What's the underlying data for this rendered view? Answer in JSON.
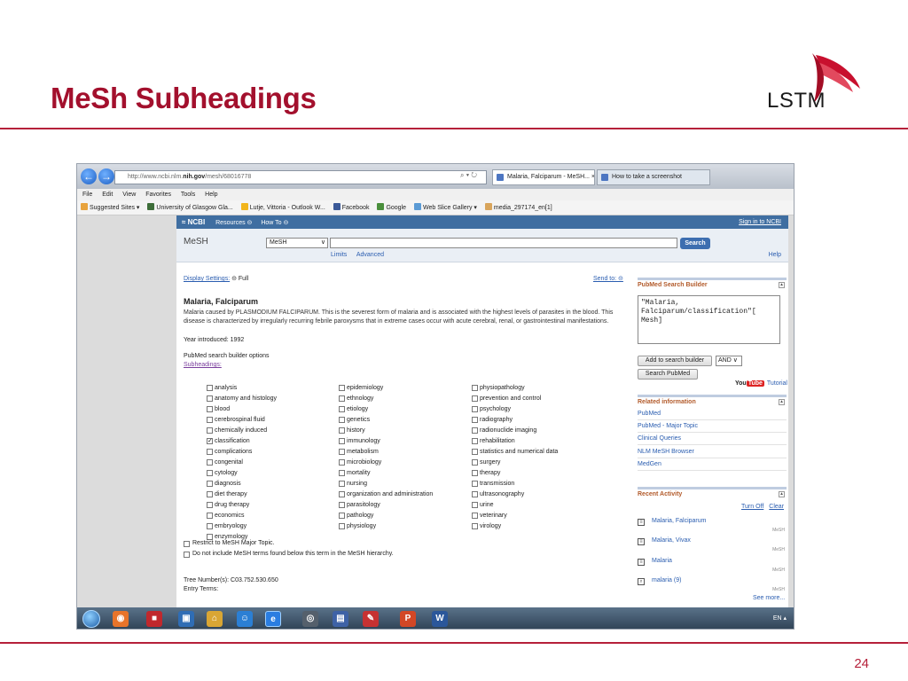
{
  "slide": {
    "title": "MeSh Subheadings",
    "logo_text": "LSTM",
    "page_number": "24"
  },
  "browser": {
    "address_prefix": "http://www.ncbi.nlm.",
    "address_host": "nih.gov",
    "address_suffix": "/mesh/68016778",
    "address_icons": "⌕ ▾ ↻",
    "back_icon": "←",
    "forward_icon": "→",
    "tabs": [
      {
        "label": "Malaria, Falciparum - MeSH... ×"
      },
      {
        "label": "How to take a screenshot"
      }
    ],
    "menu": [
      "File",
      "Edit",
      "View",
      "Favorites",
      "Tools",
      "Help"
    ],
    "favorites": [
      {
        "label": "Suggested Sites ▾",
        "color": "#e8a33d"
      },
      {
        "label": "University of Glasgow  Gla...",
        "color": "#3e6e3a"
      },
      {
        "label": "Lutje, Vittoria - Outlook W...",
        "color": "#f2b51c"
      },
      {
        "label": "Facebook",
        "color": "#3b5998"
      },
      {
        "label": "Google",
        "color": "#4a8f3c"
      },
      {
        "label": "Web Slice Gallery ▾",
        "color": "#5b9bd5"
      },
      {
        "label": "media_297174_en[1]",
        "color": "#d9a55c"
      }
    ]
  },
  "ncbi": {
    "brand": "≈ NCBI",
    "resources": "Resources ⊝",
    "howto": "How To ⊝",
    "sign_in": "Sign in to NCBI",
    "db_title": "MeSH",
    "db_selected": "MeSH",
    "chev": "∨",
    "search_button": "Search",
    "limits": "Limits",
    "advanced": "Advanced",
    "help": "Help",
    "display_settings": "Display Settings:",
    "display_value": "⊝ Full",
    "send_to": "Send to: ⊝",
    "record_title": "Malaria, Falciparum",
    "description": "Malaria caused by PLASMODIUM FALCIPARUM. This is the severest form of malaria and is associated with the highest levels of parasites in the blood. This disease is characterized by irregularly recurring febrile paroxysms that in extreme cases occur with acute cerebral, renal, or gastrointestinal manifestations.",
    "year": "Year introduced: 1992",
    "pubmed_options": "PubMed search builder options",
    "subheadings_link": "Subheadings:",
    "subheadings": {
      "col1": [
        {
          "label": "analysis",
          "checked": ""
        },
        {
          "label": "anatomy and histology",
          "checked": ""
        },
        {
          "label": "blood",
          "checked": ""
        },
        {
          "label": "cerebrospinal fluid",
          "checked": ""
        },
        {
          "label": "chemically induced",
          "checked": ""
        },
        {
          "label": "classification",
          "checked": "✓"
        },
        {
          "label": "complications",
          "checked": ""
        },
        {
          "label": "congenital",
          "checked": ""
        },
        {
          "label": "cytology",
          "checked": ""
        },
        {
          "label": "diagnosis",
          "checked": ""
        },
        {
          "label": "diet therapy",
          "checked": ""
        },
        {
          "label": "drug therapy",
          "checked": ""
        },
        {
          "label": "economics",
          "checked": ""
        },
        {
          "label": "embryology",
          "checked": ""
        },
        {
          "label": "enzymology",
          "checked": ""
        }
      ],
      "col2": [
        {
          "label": "epidemiology",
          "checked": ""
        },
        {
          "label": "ethnology",
          "checked": ""
        },
        {
          "label": "etiology",
          "checked": ""
        },
        {
          "label": "genetics",
          "checked": ""
        },
        {
          "label": "history",
          "checked": ""
        },
        {
          "label": "immunology",
          "checked": ""
        },
        {
          "label": "metabolism",
          "checked": ""
        },
        {
          "label": "microbiology",
          "checked": ""
        },
        {
          "label": "mortality",
          "checked": ""
        },
        {
          "label": "nursing",
          "checked": ""
        },
        {
          "label": "organization and administration",
          "checked": ""
        },
        {
          "label": "parasitology",
          "checked": ""
        },
        {
          "label": "pathology",
          "checked": ""
        },
        {
          "label": "physiology",
          "checked": ""
        }
      ],
      "col3": [
        {
          "label": "physiopathology",
          "checked": ""
        },
        {
          "label": "prevention and control",
          "checked": ""
        },
        {
          "label": "psychology",
          "checked": ""
        },
        {
          "label": "radiography",
          "checked": ""
        },
        {
          "label": "radionuclide imaging",
          "checked": ""
        },
        {
          "label": "rehabilitation",
          "checked": ""
        },
        {
          "label": "statistics and numerical data",
          "checked": ""
        },
        {
          "label": "surgery",
          "checked": ""
        },
        {
          "label": "therapy",
          "checked": ""
        },
        {
          "label": "transmission",
          "checked": ""
        },
        {
          "label": "ultrasonography",
          "checked": ""
        },
        {
          "label": "urine",
          "checked": ""
        },
        {
          "label": "veterinary",
          "checked": ""
        },
        {
          "label": "virology",
          "checked": ""
        }
      ]
    },
    "restrict_major": "Restrict to MeSH Major Topic.",
    "no_explode": "Do not include MeSH terms found below this term in the MeSH hierarchy.",
    "tree_number": "Tree Number(s): C03.752.530.650",
    "entry_terms": "Entry Terms:"
  },
  "rail": {
    "builder_title": "PubMed Search Builder",
    "collapse": "▴",
    "builder_text": "\"Malaria,\nFalciparum/classification\"[\nMesh]",
    "add_button": "Add to search builder",
    "and_value": "AND ∨",
    "search_pubmed": "Search PubMed",
    "you": "You",
    "tube": "Tube",
    "tutorial": "Tutorial",
    "related_title": "Related information",
    "related": [
      "PubMed",
      "PubMed - Major Topic",
      "Clinical Queries",
      "NLM MeSH Browser",
      "MedGen"
    ],
    "recent_title": "Recent Activity",
    "turn_off": "Turn Off",
    "clear": "Clear",
    "activity": [
      {
        "label": "Malaria, Falciparum",
        "db": "MeSH",
        "icon": "≡"
      },
      {
        "label": "Malaria, Vivax",
        "db": "MeSH",
        "icon": "≡"
      },
      {
        "label": "Malaria",
        "db": "MeSH",
        "icon": "≡"
      },
      {
        "label": "malaria (9)",
        "db": "MeSH",
        "icon": "⌕"
      }
    ],
    "see_more": "See more..."
  },
  "taskbar": {
    "tray_text": "EN  ▴",
    "icons": [
      {
        "glyph": "◉",
        "color": "#e8742a"
      },
      {
        "glyph": "■",
        "color": "#c0282d"
      },
      {
        "glyph": "▣",
        "color": "#2f6db5"
      },
      {
        "glyph": "⌂",
        "color": "#d9a634"
      },
      {
        "glyph": "☺",
        "color": "#2b7fd4"
      },
      {
        "glyph": "e",
        "color": "#2a7de1"
      },
      {
        "glyph": "◎",
        "color": "#55606c"
      },
      {
        "glyph": "▤",
        "color": "#3e62a6"
      },
      {
        "glyph": "✎",
        "color": "#c63232"
      },
      {
        "glyph": "P",
        "color": "#d24726"
      },
      {
        "glyph": "W",
        "color": "#2b579a"
      }
    ]
  }
}
